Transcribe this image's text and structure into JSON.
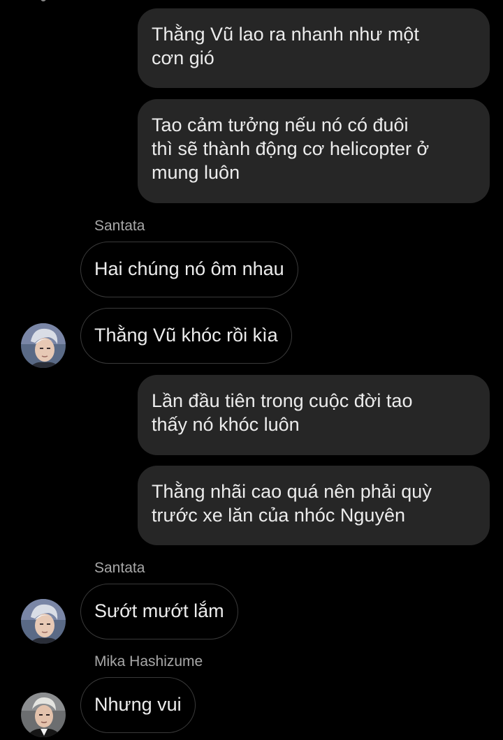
{
  "colors": {
    "background": "#000000",
    "outgoing_bubble": "#262626",
    "incoming_border": "#3a3a3a",
    "text": "#ececec",
    "sender_name": "#a8a8a8"
  },
  "messages": [
    {
      "direction": "outgoing",
      "lines": [
        "Thằng Vũ lao ra nhanh như một",
        "cơn gió"
      ]
    },
    {
      "direction": "outgoing",
      "lines": [
        "Tao cảm tưởng nếu nó có đuôi",
        "thì sẽ thành động cơ helicopter ở",
        "mung luôn"
      ]
    },
    {
      "direction": "incoming",
      "sender": "Santata",
      "text": "Hai chúng nó ôm nhau"
    },
    {
      "direction": "incoming",
      "text": "Thằng Vũ khóc rồi kìa"
    },
    {
      "direction": "outgoing",
      "lines": [
        "Lần đầu tiên trong cuộc đời tao",
        "thấy nó khóc luôn"
      ]
    },
    {
      "direction": "outgoing",
      "lines": [
        "Thằng nhãi cao quá nên phải quỳ",
        "trước xe lăn của nhóc Nguyên"
      ]
    },
    {
      "direction": "incoming",
      "sender": "Santata",
      "text": "Sướt mướt lắm"
    },
    {
      "direction": "incoming",
      "sender": "Mika Hashizume",
      "text": "Nhưng vui"
    }
  ],
  "avatars": [
    {
      "user": "Santata",
      "icon": "profile-photo-icon"
    },
    {
      "user": "Santata",
      "icon": "profile-photo-icon"
    },
    {
      "user": "Mika Hashizume",
      "icon": "profile-photo-icon"
    }
  ]
}
